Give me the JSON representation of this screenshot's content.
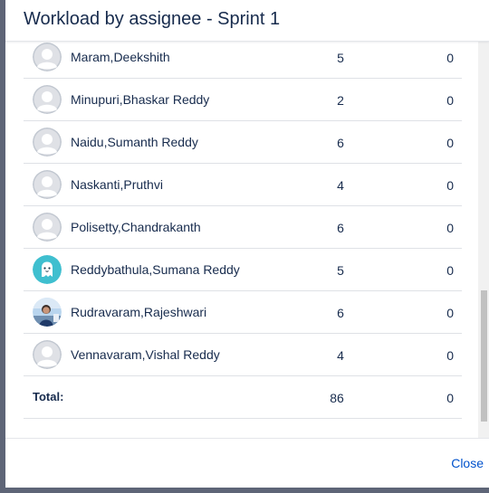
{
  "dialog": {
    "title": "Workload by assignee - Sprint 1",
    "close_label": "Close"
  },
  "rows": [
    {
      "name": "Maram,Deekshith",
      "col1": "5",
      "col2": "0",
      "avatar": "default-avatar"
    },
    {
      "name": "Minupuri,Bhaskar Reddy",
      "col1": "2",
      "col2": "0",
      "avatar": "default-avatar"
    },
    {
      "name": "Naidu,Sumanth Reddy",
      "col1": "6",
      "col2": "0",
      "avatar": "default-avatar"
    },
    {
      "name": "Naskanti,Pruthvi",
      "col1": "4",
      "col2": "0",
      "avatar": "default-avatar"
    },
    {
      "name": "Polisetty,Chandrakanth",
      "col1": "6",
      "col2": "0",
      "avatar": "default-avatar"
    },
    {
      "name": "Reddybathula,Sumana Reddy",
      "col1": "5",
      "col2": "0",
      "avatar": "ghost-avatar"
    },
    {
      "name": "Rudravaram,Rajeshwari",
      "col1": "6",
      "col2": "0",
      "avatar": "photo-avatar"
    },
    {
      "name": "Vennavaram,Vishal Reddy",
      "col1": "4",
      "col2": "0",
      "avatar": "default-avatar"
    }
  ],
  "total": {
    "label": "Total:",
    "col1": "86",
    "col2": "0"
  },
  "colors": {
    "link": "#0052cc",
    "text": "#172b4d",
    "divider": "#dfe1e6",
    "ghost_bg": "#3fbfcf"
  }
}
